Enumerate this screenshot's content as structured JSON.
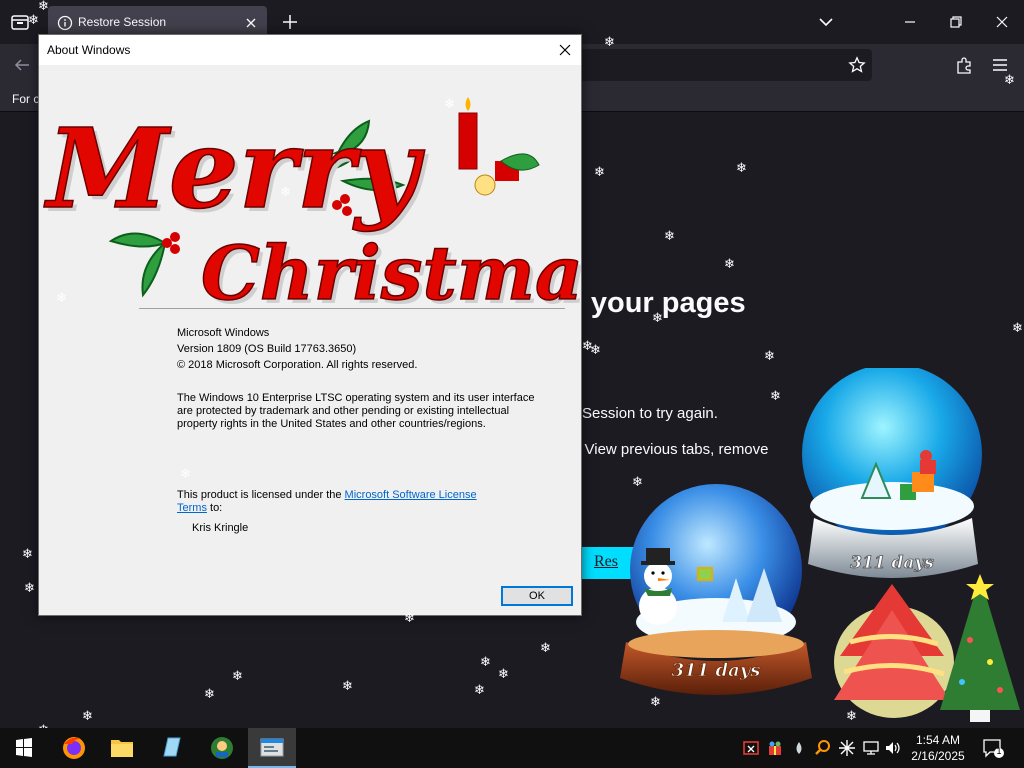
{
  "browser": {
    "tab_title": "Restore Session",
    "bookmark_item": "For c",
    "colors": {
      "background": "#1c1b22",
      "toolbar": "#2b2a33",
      "accent": "#00ddff"
    }
  },
  "page": {
    "title": "tting your pages",
    "text_line1": "tore Session to try again.",
    "text_line2": "sue. View previous tabs, remove",
    "restore_button": "Res"
  },
  "dialog": {
    "title": "About Windows",
    "banner_text_1": "Merry",
    "banner_text_2": "Christmas",
    "product": "Microsoft Windows",
    "version": "Version 1809 (OS Build 17763.3650)",
    "copyright": "© 2018 Microsoft Corporation. All rights reserved.",
    "legal_1": "The Windows 10 Enterprise LTSC operating system and its user interface",
    "legal_2": "are protected by trademark and other pending or existing intellectual",
    "legal_3": "property rights in the United States and other countries/regions.",
    "license_prefix": "This product is licensed under the ",
    "license_link_1": "Microsoft Software License",
    "license_link_2": "Terms",
    "license_suffix": " to:",
    "licensee": "Kris Kringle",
    "ok_label": "OK"
  },
  "globes": {
    "left_days": "311 days",
    "right_days": "311 days"
  },
  "taskbar": {
    "apps": [
      "start-icon",
      "firefox-icon",
      "file-explorer-icon",
      "notepad-icon",
      "desktop-app-icon",
      "about-windows-icon"
    ],
    "time": "1:54 AM",
    "date": "2/16/2025",
    "notification_count": "1"
  }
}
